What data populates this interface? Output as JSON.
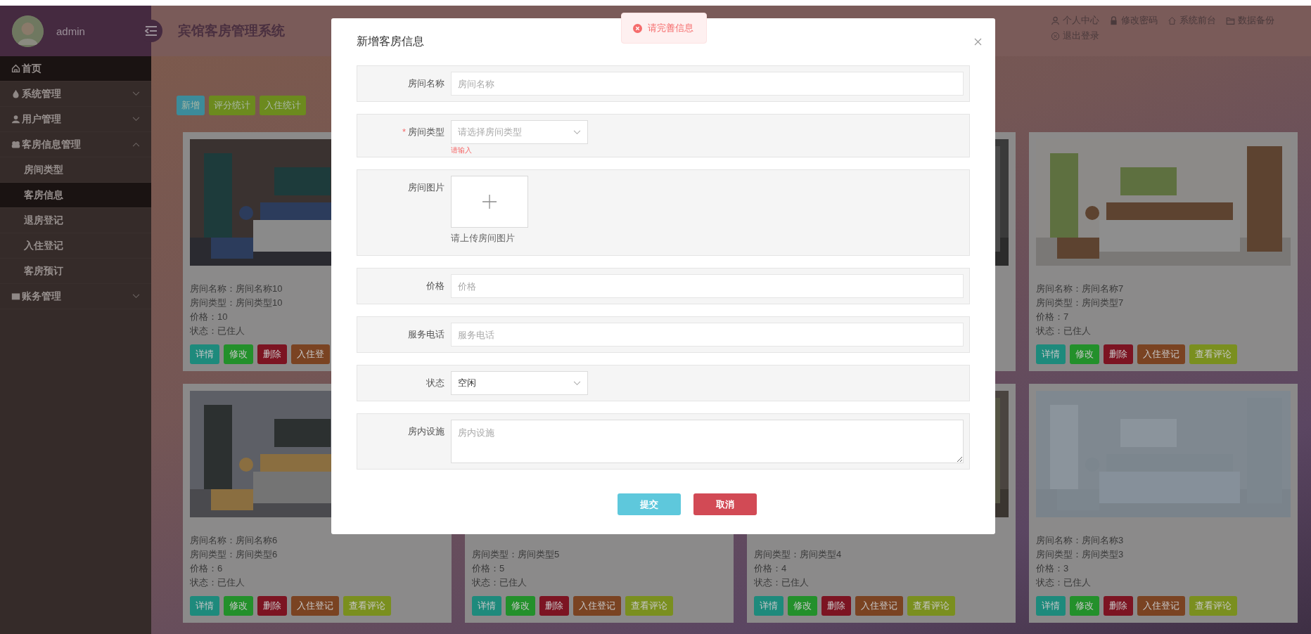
{
  "sidebar": {
    "user": "admin",
    "items": [
      {
        "label": "首页",
        "selected": true
      },
      {
        "label": "系统管理",
        "selected": false,
        "expanded": false
      },
      {
        "label": "用户管理",
        "selected": false,
        "expanded": false
      },
      {
        "label": "客房信息管理",
        "selected": false,
        "expanded": true,
        "children": [
          {
            "label": "房间类型",
            "selected": false
          },
          {
            "label": "客房信息",
            "selected": true
          },
          {
            "label": "退房登记",
            "selected": false
          },
          {
            "label": "入住登记",
            "selected": false
          },
          {
            "label": "客房预订",
            "selected": false
          }
        ]
      },
      {
        "label": "账务管理",
        "selected": false,
        "expanded": false
      }
    ]
  },
  "header": {
    "title": "宾馆客房管理系统",
    "links": [
      "个人中心",
      "修改密码",
      "系统前台",
      "数据备份",
      "退出登录"
    ]
  },
  "toolbar": [
    {
      "label": "新增",
      "color": "#3c8b9a"
    },
    {
      "label": "评分统计",
      "color": "#6c8a1e"
    },
    {
      "label": "入住统计",
      "color": "#6c8a1e"
    }
  ],
  "cards": [
    {
      "photo": true,
      "lines": [
        "房间名称：房间名称10",
        "房间类型：房间类型10",
        "价格：10",
        "状态：已住人"
      ],
      "buttons": [
        {
          "label": "详情",
          "kind": "detail"
        },
        {
          "label": "修改",
          "kind": "edit"
        },
        {
          "label": "删除",
          "kind": "delete"
        },
        {
          "label": "入住登",
          "kind": "checkin"
        }
      ]
    },
    {
      "photo": true
    },
    {
      "photo": true,
      "lines": [
        "房间名称：房间名称7",
        "房间类型：房间类型7",
        "价格：7",
        "状态：已住人"
      ],
      "buttons": [
        {
          "label": "详情",
          "kind": "detail"
        },
        {
          "label": "修改",
          "kind": "edit"
        },
        {
          "label": "删除",
          "kind": "delete"
        },
        {
          "label": "入住登记",
          "kind": "checkin"
        },
        {
          "label": "查看评论",
          "kind": "reviews"
        }
      ]
    },
    {
      "photo": true,
      "lines": [
        "房间名称：房间名称6",
        "房间类型：房间类型6",
        "价格：6",
        "状态：已住人"
      ],
      "buttons": [
        {
          "label": "详情",
          "kind": "detail"
        },
        {
          "label": "修改",
          "kind": "edit"
        },
        {
          "label": "删除",
          "kind": "delete"
        },
        {
          "label": "入住登记",
          "kind": "checkin"
        },
        {
          "label": "查看评论",
          "kind": "reviews"
        }
      ]
    },
    {
      "photo": false,
      "lines": [
        "房间类型：房间类型5",
        "价格：5",
        "状态：已住人"
      ],
      "buttons": [
        {
          "label": "详情",
          "kind": "detail"
        },
        {
          "label": "修改",
          "kind": "edit"
        },
        {
          "label": "删除",
          "kind": "delete"
        },
        {
          "label": "入住登记",
          "kind": "checkin"
        },
        {
          "label": "查看评论",
          "kind": "reviews"
        }
      ]
    },
    {
      "photo": true,
      "lines": [
        "房间类型：房间类型4",
        "价格：4",
        "状态：已住人"
      ],
      "buttons": [
        {
          "label": "详情",
          "kind": "detail"
        },
        {
          "label": "修改",
          "kind": "edit"
        },
        {
          "label": "删除",
          "kind": "delete"
        },
        {
          "label": "入住登记",
          "kind": "checkin"
        },
        {
          "label": "查看评论",
          "kind": "reviews"
        }
      ]
    },
    {
      "photo": true,
      "lines": [
        "房间名称：房间名称3",
        "房间类型：房间类型3",
        "价格：3",
        "状态：已住人"
      ],
      "buttons": [
        {
          "label": "详情",
          "kind": "detail"
        },
        {
          "label": "修改",
          "kind": "edit"
        },
        {
          "label": "删除",
          "kind": "delete"
        },
        {
          "label": "入住登记",
          "kind": "checkin"
        },
        {
          "label": "查看评论",
          "kind": "reviews"
        }
      ]
    }
  ],
  "dialog": {
    "title": "新增客房信息",
    "required_symbol": "*",
    "fields": [
      {
        "label": "房间名称",
        "kind": "input",
        "placeholder": "房间名称",
        "required": false
      },
      {
        "label": "房间类型",
        "kind": "select",
        "placeholder": "请选择房间类型",
        "required": true,
        "error": "请输入"
      },
      {
        "label": "房间图片",
        "kind": "upload",
        "hint": "请上传房间图片",
        "required": false
      },
      {
        "label": "价格",
        "kind": "input",
        "placeholder": "价格",
        "required": false
      },
      {
        "label": "服务电话",
        "kind": "input",
        "placeholder": "服务电话",
        "required": false
      },
      {
        "label": "状态",
        "kind": "select",
        "value": "空闲",
        "required": false
      },
      {
        "label": "房内设施",
        "kind": "textarea",
        "placeholder": "房内设施",
        "required": false
      }
    ],
    "buttons": [
      {
        "label": "提交",
        "kind": "primary"
      },
      {
        "label": "取消",
        "kind": "danger"
      }
    ]
  },
  "toast": {
    "message": "请完善信息"
  }
}
